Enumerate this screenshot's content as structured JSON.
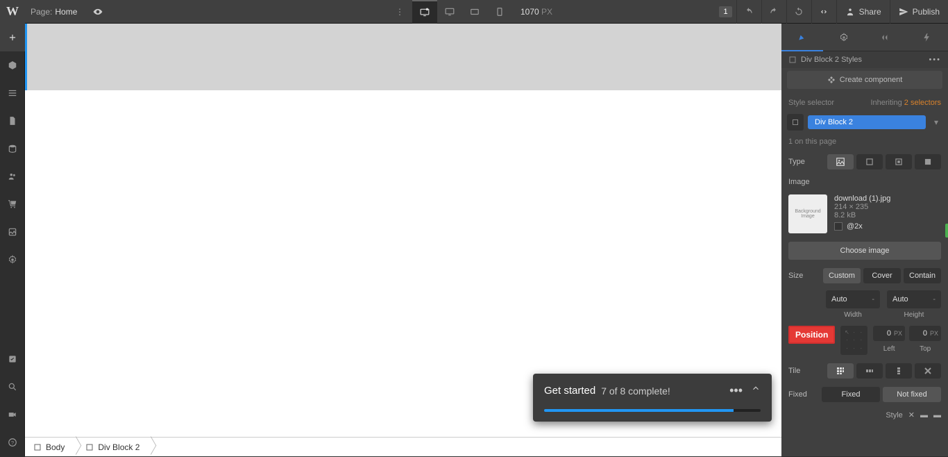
{
  "topbar": {
    "logo": "W",
    "page_label": "Page:",
    "page_name": "Home",
    "canvas_width": "1070",
    "canvas_unit": "PX",
    "notification_count": "1",
    "share": "Share",
    "publish": "Publish"
  },
  "toast": {
    "title": "Get started",
    "subtitle": "7 of 8 complete!"
  },
  "breadcrumb": {
    "body": "Body",
    "div": "Div Block 2"
  },
  "panel": {
    "header_title": "Div Block 2 Styles",
    "create_component": "Create component",
    "style_selector": "Style selector",
    "inheriting": "Inheriting",
    "selectors_link": "2 selectors",
    "selector_chip": "Div Block 2",
    "on_page": "1 on this page",
    "type": "Type",
    "image": "Image",
    "img_name": "download (1).jpg",
    "img_dim": "214 × 235",
    "img_size": "8.2 kB",
    "retina": "@2x",
    "choose": "Choose image",
    "size": "Size",
    "custom": "Custom",
    "cover": "Cover",
    "contain": "Contain",
    "auto": "Auto",
    "width": "Width",
    "height": "Height",
    "position": "Position",
    "pos_val": "0",
    "pos_unit": "PX",
    "left": "Left",
    "top": "Top",
    "tile": "Tile",
    "fixed": "Fixed",
    "not_fixed": "Not fixed",
    "style": "Style",
    "thumb_text": "Background Image"
  }
}
